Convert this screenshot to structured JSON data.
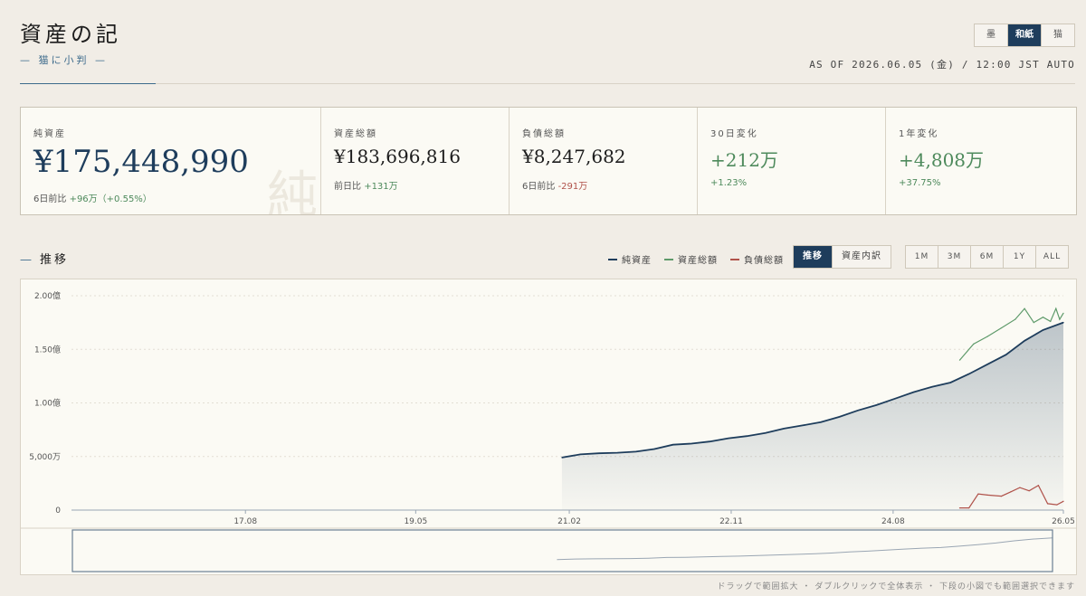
{
  "header": {
    "title": "資産の記",
    "subtitle": "— 猫に小判 —",
    "as_of": "AS OF 2026.06.05 (金) / 12:00 JST AUTO",
    "themes": [
      {
        "label": "墨",
        "active": false
      },
      {
        "label": "和紙",
        "active": true
      },
      {
        "label": "猫",
        "active": false
      }
    ]
  },
  "cards": {
    "net": {
      "label": "純資産",
      "value": "¥175,448,990",
      "sub_label": "6日前比",
      "sub_value": "+96万（+0.55%）",
      "watermark": "純"
    },
    "assets": {
      "label": "資産総額",
      "value": "¥183,696,816",
      "sub_label": "前日比",
      "sub_value": "+131万"
    },
    "liabilities": {
      "label": "負債総額",
      "value": "¥8,247,682",
      "sub_label": "6日前比",
      "sub_value": "-291万"
    },
    "change30": {
      "label": "30日変化",
      "value": "+212万",
      "sub_value": "+1.23%"
    },
    "change1y": {
      "label": "1年変化",
      "value": "+4,808万",
      "sub_value": "+37.75%"
    }
  },
  "section": {
    "title": "推移",
    "legend": [
      {
        "label": "純資産",
        "color": "#1e3d5c"
      },
      {
        "label": "資産総額",
        "color": "#5e9a6a"
      },
      {
        "label": "負債総額",
        "color": "#b0524a"
      }
    ],
    "views": [
      {
        "label": "推移",
        "active": true
      },
      {
        "label": "資産内訳",
        "active": false
      }
    ],
    "ranges": [
      "1M",
      "3M",
      "6M",
      "1Y",
      "ALL"
    ]
  },
  "chart_data": {
    "type": "line",
    "y_ticks": [
      {
        "value": 0,
        "label": "0"
      },
      {
        "value": 50000000,
        "label": "5,000万"
      },
      {
        "value": 100000000,
        "label": "1.00億"
      },
      {
        "value": 150000000,
        "label": "1.50億"
      },
      {
        "value": 200000000,
        "label": "2.00億"
      }
    ],
    "ylim": [
      0,
      200000000
    ],
    "x_range": [
      2015.7,
      2026.42
    ],
    "x_ticks": [
      {
        "value": 2017.58,
        "label": "17.08"
      },
      {
        "value": 2019.42,
        "label": "19.05"
      },
      {
        "value": 2021.08,
        "label": "21.02"
      },
      {
        "value": 2022.83,
        "label": "22.11"
      },
      {
        "value": 2024.58,
        "label": "24.08"
      },
      {
        "value": 2026.42,
        "label": "26.05"
      }
    ],
    "series": [
      {
        "name": "純資産",
        "color": "#1e3d5c",
        "area": true,
        "x": [
          2021.0,
          2021.2,
          2021.4,
          2021.6,
          2021.8,
          2022.0,
          2022.2,
          2022.4,
          2022.6,
          2022.8,
          2023.0,
          2023.2,
          2023.4,
          2023.6,
          2023.8,
          2024.0,
          2024.2,
          2024.4,
          2024.6,
          2024.8,
          2025.0,
          2025.2,
          2025.4,
          2025.6,
          2025.8,
          2026.0,
          2026.2,
          2026.42
        ],
        "values": [
          49000000,
          52000000,
          53000000,
          53500000,
          54500000,
          57000000,
          61000000,
          62000000,
          64000000,
          67000000,
          69000000,
          72000000,
          76000000,
          79000000,
          82000000,
          87000000,
          93000000,
          98000000,
          104000000,
          110000000,
          115000000,
          119000000,
          127000000,
          136000000,
          145000000,
          158000000,
          168000000,
          175000000
        ]
      },
      {
        "name": "資産総額",
        "color": "#5e9a6a",
        "area": false,
        "x": [
          2025.3,
          2025.45,
          2025.6,
          2025.75,
          2025.9,
          2026.0,
          2026.1,
          2026.2,
          2026.28,
          2026.34,
          2026.38,
          2026.42
        ],
        "values": [
          140000000,
          155000000,
          162000000,
          170000000,
          178000000,
          188000000,
          175000000,
          180000000,
          176000000,
          188000000,
          178000000,
          183700000
        ]
      },
      {
        "name": "負債総額",
        "color": "#b0524a",
        "area": false,
        "x": [
          2025.3,
          2025.4,
          2025.5,
          2025.6,
          2025.75,
          2025.85,
          2025.95,
          2026.05,
          2026.15,
          2026.25,
          2026.35,
          2026.42
        ],
        "values": [
          2000000,
          2000000,
          15000000,
          14000000,
          13000000,
          17000000,
          21000000,
          18000000,
          23000000,
          6000000,
          5000000,
          8200000
        ]
      }
    ]
  },
  "hint": "ドラッグで範囲拡大 ・ ダブルクリックで全体表示 ・ 下段の小図でも範囲選択できます"
}
